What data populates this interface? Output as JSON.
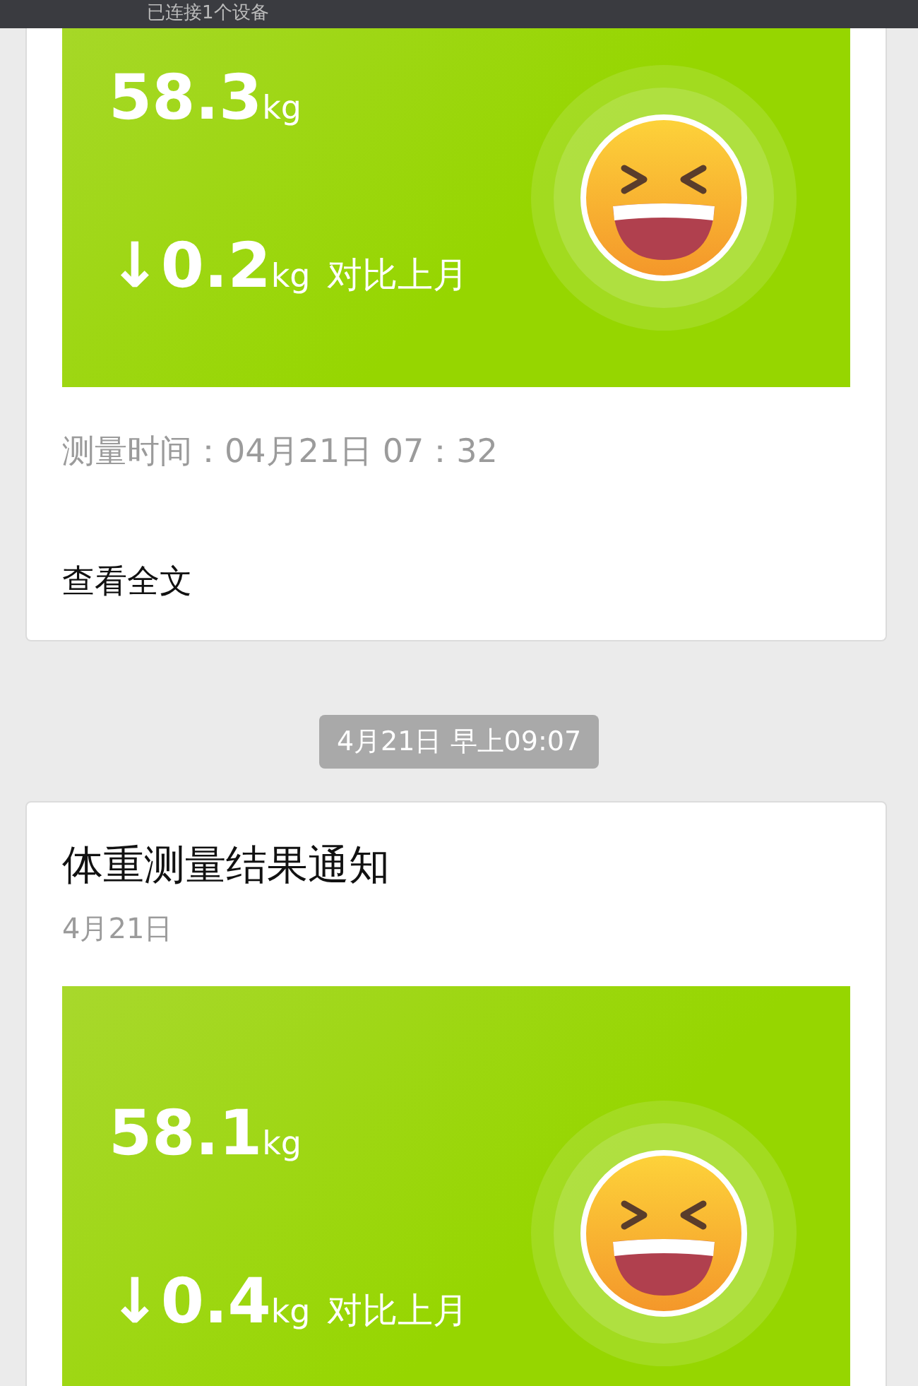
{
  "status_bar": {
    "text": "已连接1个设备"
  },
  "messages": [
    {
      "kind": "partial",
      "weight": "58.3",
      "weight_unit": "kg",
      "change": "↓0.2",
      "change_unit": "kg",
      "compare": "对比上月",
      "measure_time": "测量时间：04月21日 07：32",
      "read_more": "查看全文"
    },
    {
      "kind": "timestamp",
      "text": "4月21日 早上09:07"
    },
    {
      "kind": "full",
      "title": "体重测量结果通知",
      "date": "4月21日",
      "weight": "58.1",
      "weight_unit": "kg",
      "change": "↓0.4",
      "change_unit": "kg",
      "compare": "对比上月"
    }
  ]
}
